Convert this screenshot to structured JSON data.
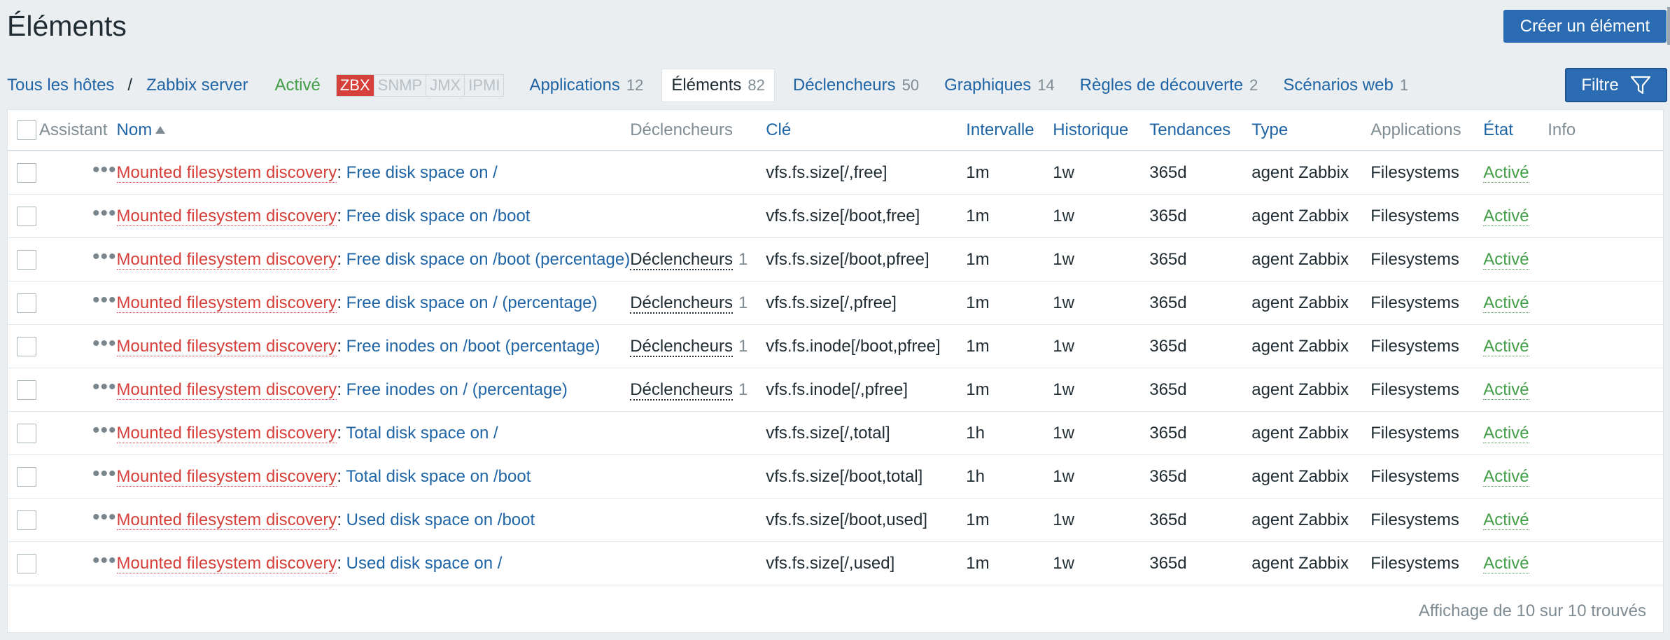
{
  "page": {
    "title": "Éléments",
    "create_label": "Créer un élément"
  },
  "nav": {
    "all_hosts": "Tous les hôtes",
    "separator": "/",
    "host": "Zabbix server",
    "status": "Activé",
    "protocols": [
      "ZBX",
      "SNMP",
      "JMX",
      "IPMI"
    ],
    "tabs": [
      {
        "label": "Applications",
        "count": "12"
      },
      {
        "label": "Éléments",
        "count": "82"
      },
      {
        "label": "Déclencheurs",
        "count": "50"
      },
      {
        "label": "Graphiques",
        "count": "14"
      },
      {
        "label": "Règles de découverte",
        "count": "2"
      },
      {
        "label": "Scénarios web",
        "count": "1"
      }
    ],
    "filter_label": "Filtre"
  },
  "table": {
    "headers": {
      "assistant": "Assistant",
      "name": "Nom",
      "triggers": "Déclencheurs",
      "key": "Clé",
      "interval": "Intervalle",
      "history": "Historique",
      "trends": "Tendances",
      "type": "Type",
      "applications": "Applications",
      "state": "État",
      "info": "Info"
    },
    "rows": [
      {
        "discovery": "Mounted filesystem discovery",
        "name": "Free disk space on /",
        "triggers": "",
        "triggers_count": "",
        "key": "vfs.fs.size[/,free]",
        "interval": "1m",
        "history": "1w",
        "trends": "365d",
        "type": "agent Zabbix",
        "applications": "Filesystems",
        "state": "Activé"
      },
      {
        "discovery": "Mounted filesystem discovery",
        "name": "Free disk space on /boot",
        "triggers": "",
        "triggers_count": "",
        "key": "vfs.fs.size[/boot,free]",
        "interval": "1m",
        "history": "1w",
        "trends": "365d",
        "type": "agent Zabbix",
        "applications": "Filesystems",
        "state": "Activé"
      },
      {
        "discovery": "Mounted filesystem discovery",
        "name": "Free disk space on /boot (percentage)",
        "triggers": "Déclencheurs",
        "triggers_count": "1",
        "key": "vfs.fs.size[/boot,pfree]",
        "interval": "1m",
        "history": "1w",
        "trends": "365d",
        "type": "agent Zabbix",
        "applications": "Filesystems",
        "state": "Activé"
      },
      {
        "discovery": "Mounted filesystem discovery",
        "name": "Free disk space on / (percentage)",
        "triggers": "Déclencheurs",
        "triggers_count": "1",
        "key": "vfs.fs.size[/,pfree]",
        "interval": "1m",
        "history": "1w",
        "trends": "365d",
        "type": "agent Zabbix",
        "applications": "Filesystems",
        "state": "Activé"
      },
      {
        "discovery": "Mounted filesystem discovery",
        "name": "Free inodes on /boot (percentage)",
        "triggers": "Déclencheurs",
        "triggers_count": "1",
        "key": "vfs.fs.inode[/boot,pfree]",
        "interval": "1m",
        "history": "1w",
        "trends": "365d",
        "type": "agent Zabbix",
        "applications": "Filesystems",
        "state": "Activé"
      },
      {
        "discovery": "Mounted filesystem discovery",
        "name": "Free inodes on / (percentage)",
        "triggers": "Déclencheurs",
        "triggers_count": "1",
        "key": "vfs.fs.inode[/,pfree]",
        "interval": "1m",
        "history": "1w",
        "trends": "365d",
        "type": "agent Zabbix",
        "applications": "Filesystems",
        "state": "Activé"
      },
      {
        "discovery": "Mounted filesystem discovery",
        "name": "Total disk space on /",
        "triggers": "",
        "triggers_count": "",
        "key": "vfs.fs.size[/,total]",
        "interval": "1h",
        "history": "1w",
        "trends": "365d",
        "type": "agent Zabbix",
        "applications": "Filesystems",
        "state": "Activé"
      },
      {
        "discovery": "Mounted filesystem discovery",
        "name": "Total disk space on /boot",
        "triggers": "",
        "triggers_count": "",
        "key": "vfs.fs.size[/boot,total]",
        "interval": "1h",
        "history": "1w",
        "trends": "365d",
        "type": "agent Zabbix",
        "applications": "Filesystems",
        "state": "Activé"
      },
      {
        "discovery": "Mounted filesystem discovery",
        "name": "Used disk space on /boot",
        "triggers": "",
        "triggers_count": "",
        "key": "vfs.fs.size[/boot,used]",
        "interval": "1m",
        "history": "1w",
        "trends": "365d",
        "type": "agent Zabbix",
        "applications": "Filesystems",
        "state": "Activé"
      },
      {
        "discovery": "Mounted filesystem discovery",
        "name": "Used disk space on /",
        "triggers": "",
        "triggers_count": "",
        "key": "vfs.fs.size[/,used]",
        "interval": "1m",
        "history": "1w",
        "trends": "365d",
        "type": "agent Zabbix",
        "applications": "Filesystems",
        "state": "Activé"
      }
    ],
    "footer": "Affichage de 10 sur 10 trouvés"
  },
  "colors": {
    "primary": "#2a6bb1",
    "link": "#1f65a6",
    "discovery": "#d6403a",
    "enabled": "#429e47",
    "muted": "#7f8c94"
  },
  "icons": {
    "filter": "funnel-icon",
    "sort": "sort-asc-icon",
    "actions": "ellipsis-icon"
  }
}
